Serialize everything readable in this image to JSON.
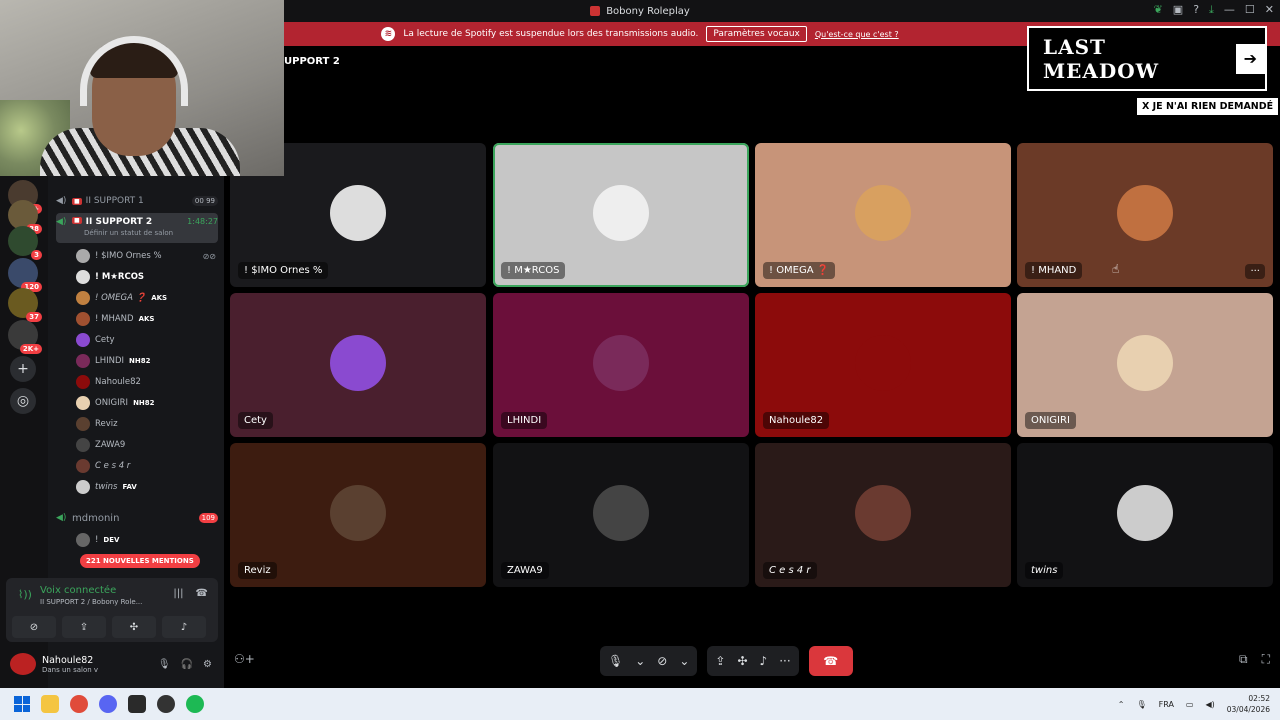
{
  "window": {
    "title": "Bobony Roleplay"
  },
  "banner": {
    "message": "La lecture de Spotify est suspendue lors des transmissions audio.",
    "button": "Paramètres vocaux",
    "link": "Qu'est-ce que c'est ?"
  },
  "guilds": [
    {
      "badge": "1K+"
    },
    {
      "badge": "38"
    },
    {
      "badge": "3"
    },
    {
      "badge": "120"
    },
    {
      "badge": "37"
    },
    {
      "badge": "2K+"
    }
  ],
  "channels": {
    "support1": {
      "name": "II SUPPORT 1",
      "count": "00",
      "limit": "99"
    },
    "support2": {
      "name": "II SUPPORT 2",
      "timer": "1:48:27",
      "status_hint": "Définir un statut de salon"
    },
    "members": [
      {
        "name": "! $IMO Ornes %",
        "tag": ""
      },
      {
        "name": "! M★RCOS",
        "tag": ""
      },
      {
        "name": "! OMEGA ❓",
        "tag": "AKS"
      },
      {
        "name": "! MHAND",
        "tag": "AKS"
      },
      {
        "name": "Cety",
        "tag": ""
      },
      {
        "name": "LHINDI",
        "tag": "NH82"
      },
      {
        "name": "Nahoule82",
        "tag": ""
      },
      {
        "name": "ONIGIRI",
        "tag": "NH82"
      },
      {
        "name": "Reviz",
        "tag": ""
      },
      {
        "name": "ZAWA9",
        "tag": ""
      },
      {
        "name": "C e s 4 r",
        "tag": ""
      },
      {
        "name": "twins",
        "tag": "FAV"
      }
    ],
    "mdmonin": {
      "name": "mdmonin",
      "badge": "109"
    },
    "dev_member": {
      "name": "!",
      "tag": "DEV"
    },
    "mentions_pill": "221 NOUVELLES MENTIONS"
  },
  "voice_panel": {
    "status": "Voix connectée",
    "subtitle": "II SUPPORT 2 / Bobony Role..."
  },
  "user_panel": {
    "username": "Nahoule82",
    "status": "Dans un salon v"
  },
  "stage": {
    "title": "UPPORT 2",
    "tiles": [
      {
        "label": "! $IMO Ornes %",
        "bg": "#1a1a1d",
        "av": "#ddd"
      },
      {
        "label": "! M★RCOS",
        "bg": "#c6c6c6",
        "av": "#eee"
      },
      {
        "label": "! OMEGA ❓",
        "bg": "#c79479",
        "av": "#d8a060"
      },
      {
        "label": "! MHAND",
        "bg": "#6b3a27",
        "av": "#c07040"
      },
      {
        "label": "Cety",
        "bg": "#4a1f2e",
        "av": "#8a4ad0"
      },
      {
        "label": "LHINDI",
        "bg": "#6b0f3a",
        "av": "#7a2a5a"
      },
      {
        "label": "Nahoule82",
        "bg": "#8c0b0b",
        "av": "#8c0b0b"
      },
      {
        "label": "ONIGIRI",
        "bg": "#c4a392",
        "av": "#e8d0b0"
      },
      {
        "label": "Reviz",
        "bg": "#3d1c10",
        "av": "#5a4030"
      },
      {
        "label": "ZAWA9",
        "bg": "#121214",
        "av": "#444"
      },
      {
        "label": "C e s 4 r",
        "bg": "#2a1a18",
        "av": "#6a3a30"
      },
      {
        "label": "twins",
        "bg": "#121214",
        "av": "#ccc"
      }
    ]
  },
  "overlay": {
    "logo": "LAST MEADOW",
    "tag": "X JE N'AI RIEN DEMANDÉ"
  },
  "taskbar": {
    "lang": "FRA",
    "time": "02:52",
    "date": "03/04/2026"
  }
}
